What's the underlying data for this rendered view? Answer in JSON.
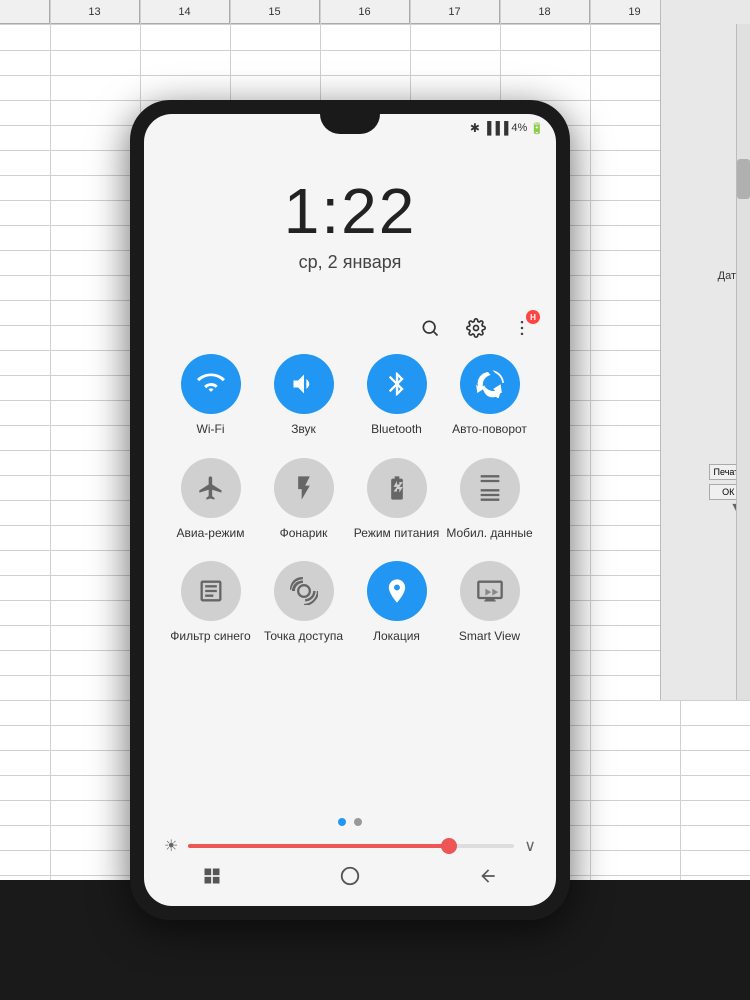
{
  "spreadsheet": {
    "columns": [
      "13",
      "14",
      "15",
      "16",
      "17",
      "18",
      "19"
    ],
    "right_labels": [
      "Дата"
    ],
    "buttons": [
      "Печать",
      "ОК"
    ]
  },
  "phone": {
    "status": {
      "bluetooth": "✱",
      "signal": "▐▐▐",
      "battery": "4%"
    },
    "clock": {
      "time": "1:22",
      "date": "ср, 2 января"
    },
    "action_icons": {
      "search": "🔍",
      "settings": "⚙",
      "more": "⋮",
      "notification_count": "H"
    },
    "quick_settings": {
      "row1": [
        {
          "id": "wifi",
          "label": "Wi-Fi",
          "active": true,
          "icon": "wifi"
        },
        {
          "id": "sound",
          "label": "Звук",
          "active": true,
          "icon": "sound"
        },
        {
          "id": "bluetooth",
          "label": "Bluetooth",
          "active": true,
          "icon": "bluetooth"
        },
        {
          "id": "autorotate",
          "label": "Авто-поворот",
          "active": true,
          "icon": "autorotate"
        }
      ],
      "row2": [
        {
          "id": "airplane",
          "label": "Авиа-режим",
          "active": false,
          "icon": "airplane"
        },
        {
          "id": "flashlight",
          "label": "Фонарик",
          "active": false,
          "icon": "flashlight"
        },
        {
          "id": "battery_saver",
          "label": "Режим питания",
          "active": false,
          "icon": "battery"
        },
        {
          "id": "mobile_data",
          "label": "Мобил. данные",
          "active": false,
          "icon": "data"
        }
      ],
      "row3": [
        {
          "id": "blue_filter",
          "label": "Фильтр синего",
          "active": false,
          "icon": "filter"
        },
        {
          "id": "hotspot",
          "label": "Точка доступа",
          "active": false,
          "icon": "hotspot"
        },
        {
          "id": "location",
          "label": "Локация",
          "active": true,
          "icon": "location"
        },
        {
          "id": "smart_view",
          "label": "Smart View",
          "active": false,
          "icon": "cast"
        }
      ]
    },
    "brightness": {
      "value": 80,
      "sun_icon": "☀"
    },
    "nav": {
      "back": "◀",
      "home": "◯",
      "recent": "▐▐"
    }
  }
}
